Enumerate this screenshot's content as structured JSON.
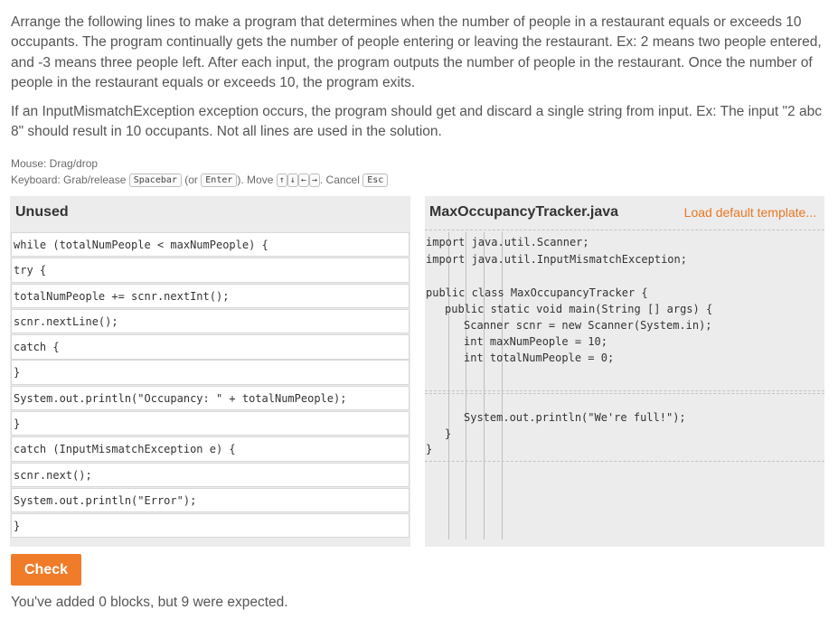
{
  "prompt": {
    "paragraph1": "Arrange the following lines to make a program that determines when the number of people in a restaurant equals or exceeds 10 occupants. The program continually gets the number of people entering or leaving the restaurant. Ex: 2 means two people entered, and -3 means three people left. After each input, the program outputs the number of people in the restaurant. Once the number of people in the restaurant equals or exceeds 10, the program exits.",
    "paragraph2": "If an InputMismatchException exception occurs, the program should get and discard a single string from input. Ex: The input \"2 abc 8\" should result in 10 occupants. Not all lines are used in the solution."
  },
  "help": {
    "mouse": "Mouse: Drag/drop",
    "keyboard_prefix": "Keyboard: Grab/release",
    "spacebar": "Spacebar",
    "or_open": "(or",
    "enter": "Enter",
    "move": "). Move",
    "up": "↑",
    "down": "↓",
    "left": "←",
    "right": "→",
    "cancel": ". Cancel",
    "esc": "Esc"
  },
  "unused": {
    "title": "Unused",
    "blocks": [
      "while (totalNumPeople < maxNumPeople) {",
      "try {",
      "totalNumPeople += scnr.nextInt();",
      "scnr.nextLine();",
      "catch {",
      "}",
      "System.out.println(\"Occupancy: \" + totalNumPeople);",
      "}",
      "catch (InputMismatchException e) {",
      "scnr.next();",
      "System.out.println(\"Error\");",
      "}"
    ]
  },
  "editor": {
    "filename": "MaxOccupancyTracker.java",
    "load_default": "Load default template...",
    "lines": {
      "import1": "import java.util.Scanner;",
      "import2": "import java.util.InputMismatchException;",
      "class_decl": "public class MaxOccupancyTracker {",
      "main_decl": "public static void main(String [] args) {",
      "scanner": "Scanner scnr = new Scanner(System.in);",
      "max": "int maxNumPeople = 10;",
      "total": "int totalNumPeople = 0;",
      "full": "System.out.println(\"We're full!\");",
      "close_main": "}",
      "close_class": "}"
    }
  },
  "check_label": "Check",
  "status": "You've added 0 blocks, but 9 were expected.",
  "colors": {
    "accent": "#f07c2a",
    "link": "#e87722",
    "panel": "#ececec"
  }
}
